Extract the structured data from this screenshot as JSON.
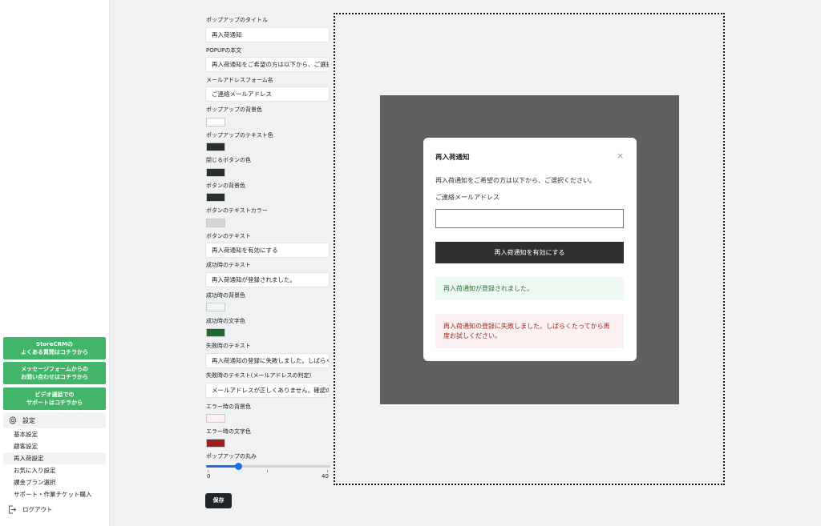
{
  "sidebar": {
    "support_buttons": [
      {
        "line1": "StoreCRMの",
        "line2": "よくある質問はコチラから"
      },
      {
        "line1": "メッセージフォームからの",
        "line2": "お問い合わせはコチラから"
      },
      {
        "line1": "ビデオ通話での",
        "line2": "サポートはコチラから"
      }
    ],
    "settings_label": "設定",
    "items": [
      {
        "label": "基本設定"
      },
      {
        "label": "顧客設定"
      },
      {
        "label": "再入荷設定"
      },
      {
        "label": "お気に入り設定"
      },
      {
        "label": "課金プラン選択"
      },
      {
        "label": "サポート・作業チケット購入"
      }
    ],
    "logout_label": "ログアウト"
  },
  "form": {
    "popup_title_label": "ポップアップのタイトル",
    "popup_title_value": "再入荷通知",
    "popup_body_label": "POPUPの本文",
    "popup_body_value": "再入荷通知をご希望の方は以下から、ご選択ください。",
    "email_form_label": "メールアドレスフォーム名",
    "email_form_value": "ご連絡メールアドレス",
    "bg_color_label": "ポップアップの背景色",
    "text_color_label": "ポップアップのテキスト色",
    "close_btn_color_label": "閉じるボタンの色",
    "btn_bg_label": "ボタンの背景色",
    "btn_text_color_label": "ボタンのテキストカラー",
    "btn_text_label": "ボタンのテキスト",
    "btn_text_value": "再入荷通知を有効にする",
    "success_text_label": "成功時のテキスト",
    "success_text_value": "再入荷通知が登録されました。",
    "success_bg_label": "成功時の背景色",
    "success_fg_label": "成功時の文字色",
    "fail_text_label": "失敗時のテキスト",
    "fail_text_value": "再入荷通知の登録に失敗しました。しばらくたってから再度お試しください。",
    "fail_email_label": "失敗時のテキスト(メールアドレスの判定)",
    "fail_email_value": "メールアドレスが正しくありません。確認の上、再度入力してください。",
    "error_bg_label": "エラー時の背景色",
    "error_fg_label": "エラー時の文字色",
    "radius_label": "ポップアップの丸み",
    "radius_value": 7,
    "radius_min": "0",
    "radius_max": "40",
    "save_label": "保存"
  },
  "colors": {
    "popup_bg": "#ffffff",
    "popup_text": "#2b2f2c",
    "close_btn": "#2b2f2c",
    "btn_bg": "#2b2f2c",
    "btn_text": "#d6d6d6",
    "success_bg": "#eefaf1",
    "success_fg": "#1f6a32",
    "error_bg": "#fdf0f0",
    "error_fg": "#9a1f1f"
  },
  "preview": {
    "title": "再入荷通知",
    "close_icon": "×",
    "body": "再入荷通知をご希望の方は以下から、ご選択ください。",
    "email_label": "ご連絡メールアドレス",
    "button": "再入荷通知を有効にする",
    "success": "再入荷通知が登録されました。",
    "error": "再入荷通知の登録に失敗しました。しばらくたってから再度お試しください。"
  }
}
